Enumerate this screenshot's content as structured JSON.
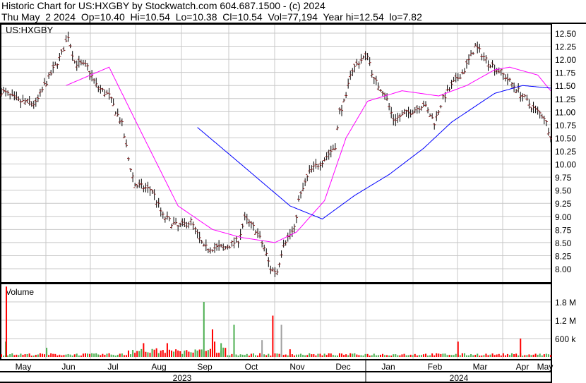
{
  "header": {
    "title": "Historic Chart for US:HXGBY by Stockwatch.com 604.687.1500 - (c) 2024",
    "quote": "Thu May  2 2024  Op=10.40  Hi=10.54  Lo=10.38  Cl=10.54  Vol=77,194  Year hi=12.54  lo=7.82"
  },
  "chart_data": {
    "type": "candlestick",
    "symbol": "US:HXGBY",
    "volume_label": "Volume",
    "price_ticks": [
      "12.50",
      "12.25",
      "12.00",
      "11.75",
      "11.50",
      "11.25",
      "11.00",
      "10.75",
      "10.50",
      "10.25",
      "10.00",
      "9.75",
      "9.50",
      "9.25",
      "9.00",
      "8.75",
      "8.50",
      "8.25",
      "8.00"
    ],
    "price_range": [
      7.75,
      12.75
    ],
    "volume_ticks": [
      "1.8 M",
      "1.2 M",
      "600 k"
    ],
    "months": [
      "May",
      "Jun",
      "Jul",
      "Aug",
      "Sep",
      "Oct",
      "Nov",
      "Dec",
      "Jan",
      "Feb",
      "Mar",
      "Apr",
      "May"
    ],
    "years": [
      "2023",
      "2024"
    ],
    "price_keypoints_day_close": [
      [
        0,
        11.4
      ],
      [
        8,
        11.2
      ],
      [
        16,
        11.15
      ],
      [
        20,
        11.5
      ],
      [
        24,
        11.8
      ],
      [
        28,
        12.1
      ],
      [
        31,
        12.45
      ],
      [
        34,
        11.95
      ],
      [
        40,
        11.85
      ],
      [
        44,
        11.5
      ],
      [
        50,
        11.3
      ],
      [
        56,
        10.75
      ],
      [
        59,
        10.1
      ],
      [
        62,
        9.6
      ],
      [
        70,
        9.5
      ],
      [
        75,
        9.0
      ],
      [
        82,
        8.8
      ],
      [
        88,
        8.9
      ],
      [
        94,
        8.4
      ],
      [
        104,
        8.4
      ],
      [
        110,
        8.55
      ],
      [
        113,
        8.95
      ],
      [
        118,
        8.75
      ],
      [
        122,
        8.4
      ],
      [
        125,
        8.0
      ],
      [
        128,
        7.95
      ],
      [
        131,
        8.5
      ],
      [
        136,
        8.75
      ],
      [
        138,
        9.3
      ],
      [
        143,
        9.85
      ],
      [
        150,
        10.1
      ],
      [
        155,
        10.35
      ],
      [
        157,
        11.0
      ],
      [
        160,
        11.25
      ],
      [
        162,
        11.75
      ],
      [
        166,
        11.95
      ],
      [
        170,
        12.1
      ],
      [
        173,
        11.6
      ],
      [
        178,
        11.35
      ],
      [
        182,
        10.85
      ],
      [
        190,
        11.0
      ],
      [
        196,
        11.15
      ],
      [
        201,
        10.8
      ],
      [
        205,
        11.25
      ],
      [
        210,
        11.55
      ],
      [
        215,
        11.8
      ],
      [
        220,
        12.25
      ],
      [
        226,
        11.95
      ],
      [
        232,
        11.75
      ],
      [
        240,
        11.4
      ],
      [
        246,
        11.1
      ],
      [
        252,
        10.9
      ],
      [
        255,
        10.54
      ]
    ],
    "ma_short": [
      [
        30,
        11.5
      ],
      [
        50,
        11.85
      ],
      [
        65,
        10.6
      ],
      [
        82,
        9.2
      ],
      [
        98,
        8.75
      ],
      [
        111,
        8.6
      ],
      [
        127,
        8.5
      ],
      [
        137,
        8.7
      ],
      [
        150,
        9.3
      ],
      [
        160,
        10.5
      ],
      [
        170,
        11.2
      ],
      [
        186,
        11.4
      ],
      [
        203,
        11.3
      ],
      [
        216,
        11.5
      ],
      [
        229,
        11.8
      ],
      [
        236,
        11.85
      ],
      [
        249,
        11.7
      ],
      [
        255,
        11.4
      ]
    ],
    "ma_long": [
      [
        91,
        10.7
      ],
      [
        114,
        9.9
      ],
      [
        134,
        9.2
      ],
      [
        149,
        8.95
      ],
      [
        164,
        9.4
      ],
      [
        180,
        9.8
      ],
      [
        196,
        10.3
      ],
      [
        209,
        10.8
      ],
      [
        229,
        11.35
      ],
      [
        242,
        11.5
      ],
      [
        255,
        11.45
      ]
    ],
    "volume_spikes": [
      [
        2,
        500000,
        "green"
      ],
      [
        2.3,
        2300000,
        "red"
      ],
      [
        21,
        300000,
        "green"
      ],
      [
        66,
        450000,
        "red"
      ],
      [
        77,
        450000,
        "red"
      ],
      [
        94,
        1800000,
        "green"
      ],
      [
        98,
        900000,
        "red"
      ],
      [
        99,
        500000,
        "red"
      ],
      [
        102,
        450000,
        "green"
      ],
      [
        108,
        1050000,
        "green"
      ],
      [
        121,
        550000,
        "gray"
      ],
      [
        126,
        1350000,
        "red"
      ],
      [
        130,
        1050000,
        "gray"
      ],
      [
        134,
        250000,
        "red"
      ],
      [
        212,
        500000,
        "red"
      ],
      [
        241,
        600000,
        "red"
      ]
    ]
  },
  "colors": {
    "up": "#8b1a1a",
    "green": "#4caf50",
    "red": "#ff0000",
    "gray": "#a0a0a0",
    "ma_short": "#ff00ff",
    "ma_long": "#0000ff",
    "grid": "#c8c8c8"
  }
}
